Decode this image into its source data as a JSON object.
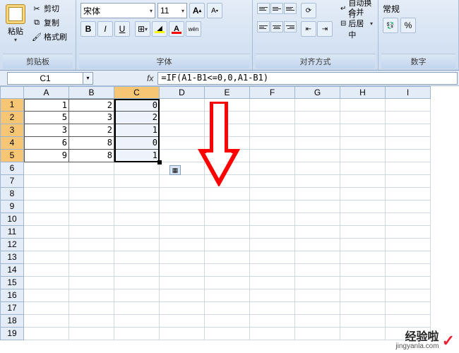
{
  "ribbon": {
    "clipboard": {
      "paste": "粘贴",
      "cut": "剪切",
      "copy": "复制",
      "format_painter": "格式刷",
      "title": "剪贴板"
    },
    "font": {
      "name": "宋体",
      "size": "11",
      "bold": "B",
      "italic": "I",
      "underline": "U",
      "wen": "wén",
      "title": "字体"
    },
    "align": {
      "wrap": "自动换行",
      "merge": "合并后居中",
      "title": "对齐方式"
    },
    "number": {
      "general": "常规",
      "percent": "%",
      "title": "数字"
    }
  },
  "cell_ref": "C1",
  "formula": "=IF(A1-B1<=0,0,A1-B1)",
  "columns": [
    "A",
    "B",
    "C",
    "D",
    "E",
    "F",
    "G",
    "H",
    "I"
  ],
  "rows": [
    "1",
    "2",
    "3",
    "4",
    "5",
    "6",
    "7",
    "8",
    "9",
    "10",
    "11",
    "12",
    "13",
    "14",
    "15",
    "16",
    "17",
    "18",
    "19"
  ],
  "selected_col_index": 2,
  "selected_rows": [
    0,
    1,
    2,
    3,
    4
  ],
  "cells_A": [
    "1",
    "5",
    "3",
    "6",
    "9"
  ],
  "cells_B": [
    "2",
    "3",
    "2",
    "8",
    "8"
  ],
  "cells_C": [
    "0",
    "2",
    "1",
    "0",
    "1"
  ],
  "selection": {
    "col": "C",
    "row_start": 1,
    "row_end": 5
  },
  "autofill_icon": "▦",
  "watermark": {
    "text": "经验啦",
    "url": "jingyanla.com",
    "check": "✓"
  }
}
